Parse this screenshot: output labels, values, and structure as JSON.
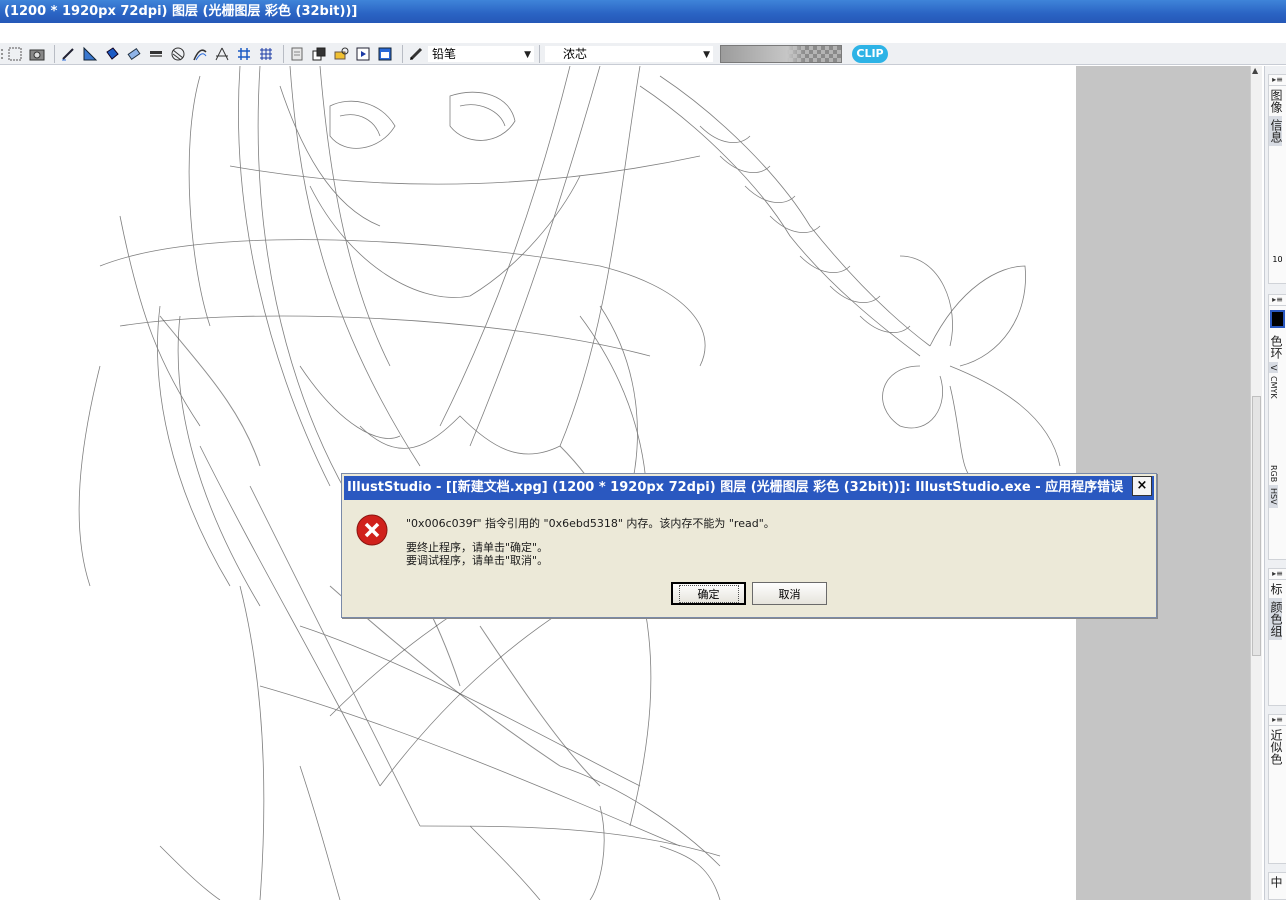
{
  "window": {
    "title": "(1200 * 1920px 72dpi)    图层 (光栅图层 彩色 (32bit))]"
  },
  "toolbar": {
    "tool_select": "铅笔",
    "brush_select": "浓芯",
    "clip_button": "CLIP"
  },
  "right_panel": {
    "group1_tabs": [
      "图像",
      "信息"
    ],
    "group1_value": "10",
    "group2_tabs": [
      "色环",
      "V",
      "CMYK",
      "RGB",
      "HSV"
    ],
    "group3_tabs": [
      "标",
      "颜色组"
    ],
    "group4_tabs": [
      "近似色"
    ],
    "group5_tabs": [
      "中"
    ]
  },
  "dialog": {
    "title": "IllustStudio - [[新建文档.xpg] (1200 * 1920px 72dpi)    图层 (光栅图层 彩色 (32bit))]: IllustStudio.exe - 应用程序错误",
    "close_label": "×",
    "message_line1": "\"0x006c039f\" 指令引用的 \"0x6ebd5318\" 内存。该内存不能为 \"read\"。",
    "message_line2": "要终止程序，请单击\"确定\"。",
    "message_line3": "要调试程序，请单击\"取消\"。",
    "ok_label": "确定",
    "cancel_label": "取消"
  },
  "colors": {
    "titlebar": "#2a63c3",
    "dialog_title": "#2a58c0",
    "error_icon": "#d0211c",
    "clip_button": "#2db3e6"
  }
}
